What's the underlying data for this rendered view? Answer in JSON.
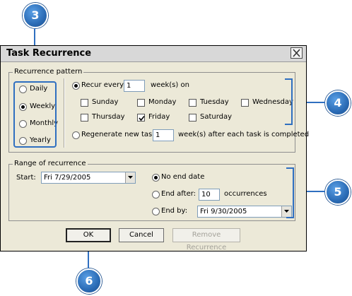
{
  "dialog": {
    "title": "Task Recurrence",
    "close_glyph": "×"
  },
  "recurrence_pattern": {
    "legend": "Recurrence pattern",
    "frequency_options": [
      {
        "label": "Daily",
        "checked": false
      },
      {
        "label": "Weekly",
        "checked": true
      },
      {
        "label": "Monthly",
        "checked": false
      },
      {
        "label": "Yearly",
        "checked": false
      }
    ],
    "recur_every_label": "Recur every",
    "recur_every_value": "1",
    "weeks_on_label": "week(s) on",
    "days": [
      {
        "label": "Sunday",
        "checked": false
      },
      {
        "label": "Monday",
        "checked": false
      },
      {
        "label": "Tuesday",
        "checked": false
      },
      {
        "label": "Wednesday",
        "checked": false
      },
      {
        "label": "Thursday",
        "checked": false
      },
      {
        "label": "Friday",
        "checked": true
      },
      {
        "label": "Saturday",
        "checked": false
      }
    ],
    "regenerate_label": "Regenerate new task",
    "regenerate_value": "1",
    "regenerate_suffix": "week(s) after each task is completed"
  },
  "range_of_recurrence": {
    "legend": "Range of recurrence",
    "start_label": "Start:",
    "start_value": "Fri 7/29/2005",
    "no_end_date_label": "No end date",
    "end_after_label": "End after:",
    "end_after_value": "10",
    "occurrences_label": "occurrences",
    "end_by_label": "End by:",
    "end_by_value": "Fri 9/30/2005"
  },
  "buttons": {
    "ok": "OK",
    "cancel": "Cancel",
    "remove_recurrence": "Remove Recurrence"
  },
  "callouts": [
    "3",
    "4",
    "5",
    "6"
  ],
  "colors": {
    "callout_blue": "#2a6bb5",
    "dialog_bg": "#ece9d8"
  }
}
